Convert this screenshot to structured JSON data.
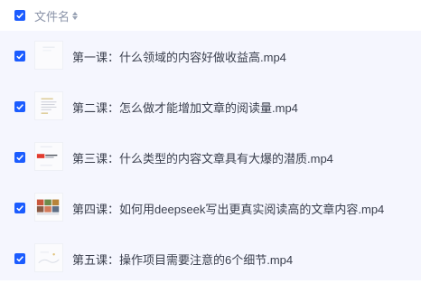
{
  "header": {
    "column_label": "文件名"
  },
  "rows": [
    {
      "name": "第一课：什么领域的内容好做收益高.mp4",
      "thumb": "blank-doc"
    },
    {
      "name": "第二课：怎么做才能增加文章的阅读量.mp4",
      "thumb": "text-doc"
    },
    {
      "name": "第三课：什么类型的内容文章具有大爆的潜质.mp4",
      "thumb": "red-banner-doc"
    },
    {
      "name": "第四课：如何用deepseek写出更真实阅读高的文章内容.mp4",
      "thumb": "photo-grid-doc"
    },
    {
      "name": "第五课：操作项目需要注意的6个细节.mp4",
      "thumb": "sketch-doc"
    }
  ],
  "colors": {
    "accent": "#1b5cff",
    "list_bg": "#f5f6fe"
  }
}
